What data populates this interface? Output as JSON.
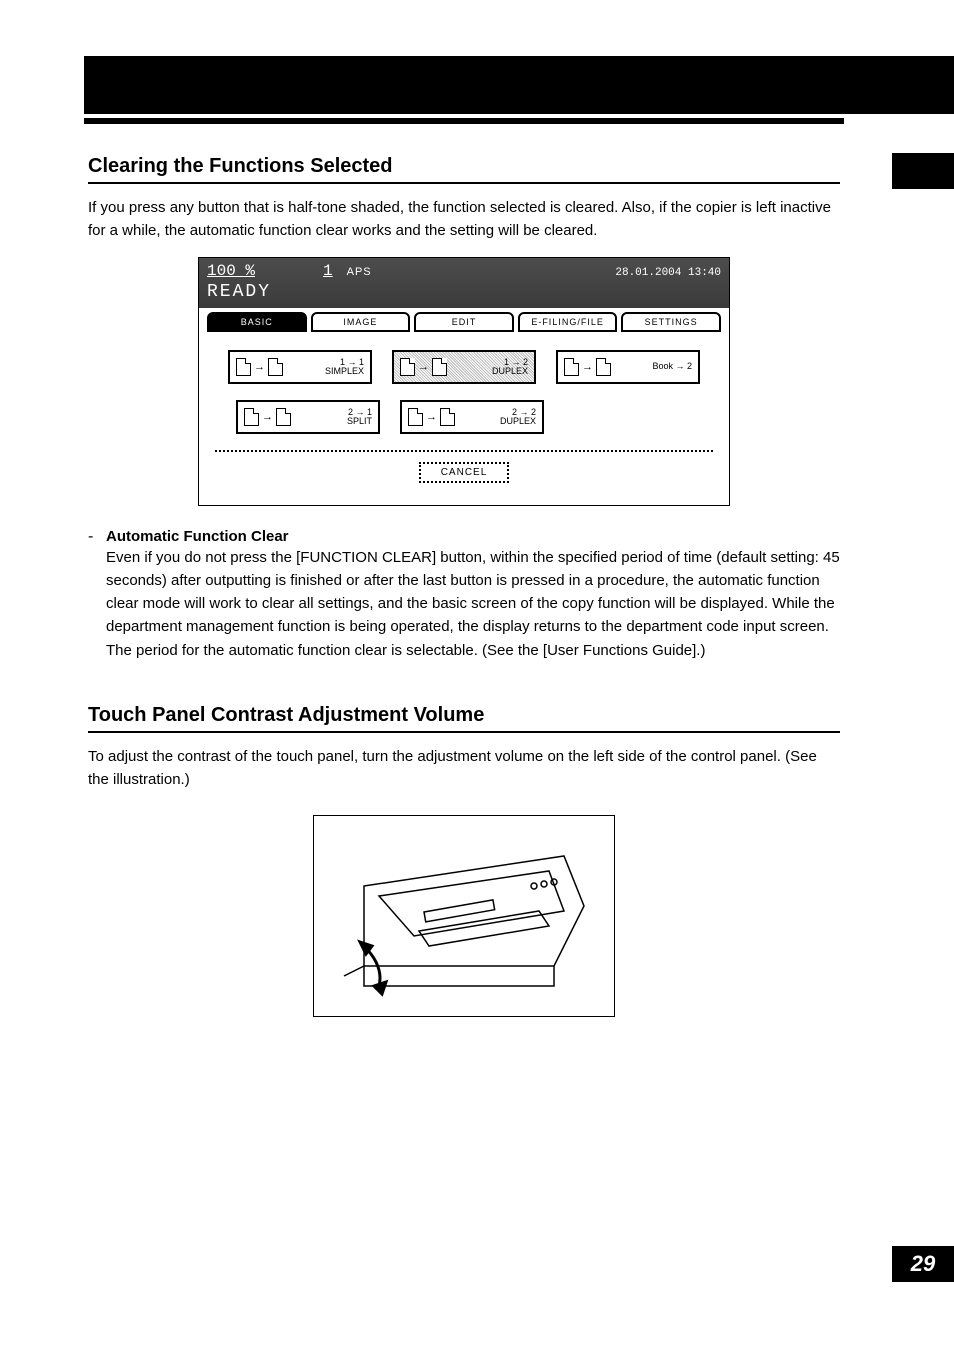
{
  "page_number": "29",
  "section1": {
    "heading": "Clearing the Functions Selected",
    "intro": "If you press any button that is half-tone shaded, the function selected is cleared. Also, if the copier is left inactive for a while, the automatic function clear works and the setting will be cleared.",
    "sub_heading": "Automatic Function Clear",
    "sub_body1": "Even if you do not press the [FUNCTION CLEAR] button, within the specified period of time (default setting: 45 seconds) after outputting is finished or after the last button is pressed in a procedure, the automatic function clear mode will work to clear all settings, and the basic screen of the copy function will be displayed. While the department management function is being operated, the display returns to the department code input screen.",
    "sub_body2": "The period for the automatic function clear is selectable. (See the [User Functions Guide].)"
  },
  "section2": {
    "heading": "Touch Panel Contrast Adjustment Volume",
    "intro": "To adjust the contrast of the touch panel, turn the adjustment volume on the left side of the control panel. (See the illustration.)"
  },
  "screenshot": {
    "percent": "100 %",
    "count": "1",
    "mode": "APS",
    "datetime": "28.01.2004 13:40",
    "status": "READY",
    "tabs": [
      "BASIC",
      "IMAGE",
      "EDIT",
      "E-FILING/FILE",
      "SETTINGS"
    ],
    "buttons": {
      "simplex": "1 → 1\nSIMPLEX",
      "duplex12": "1 → 2\nDUPLEX",
      "book2": "Book → 2",
      "split": "2 → 1\nSPLIT",
      "duplex22": "2 → 2\nDUPLEX"
    },
    "cancel": "CANCEL"
  }
}
